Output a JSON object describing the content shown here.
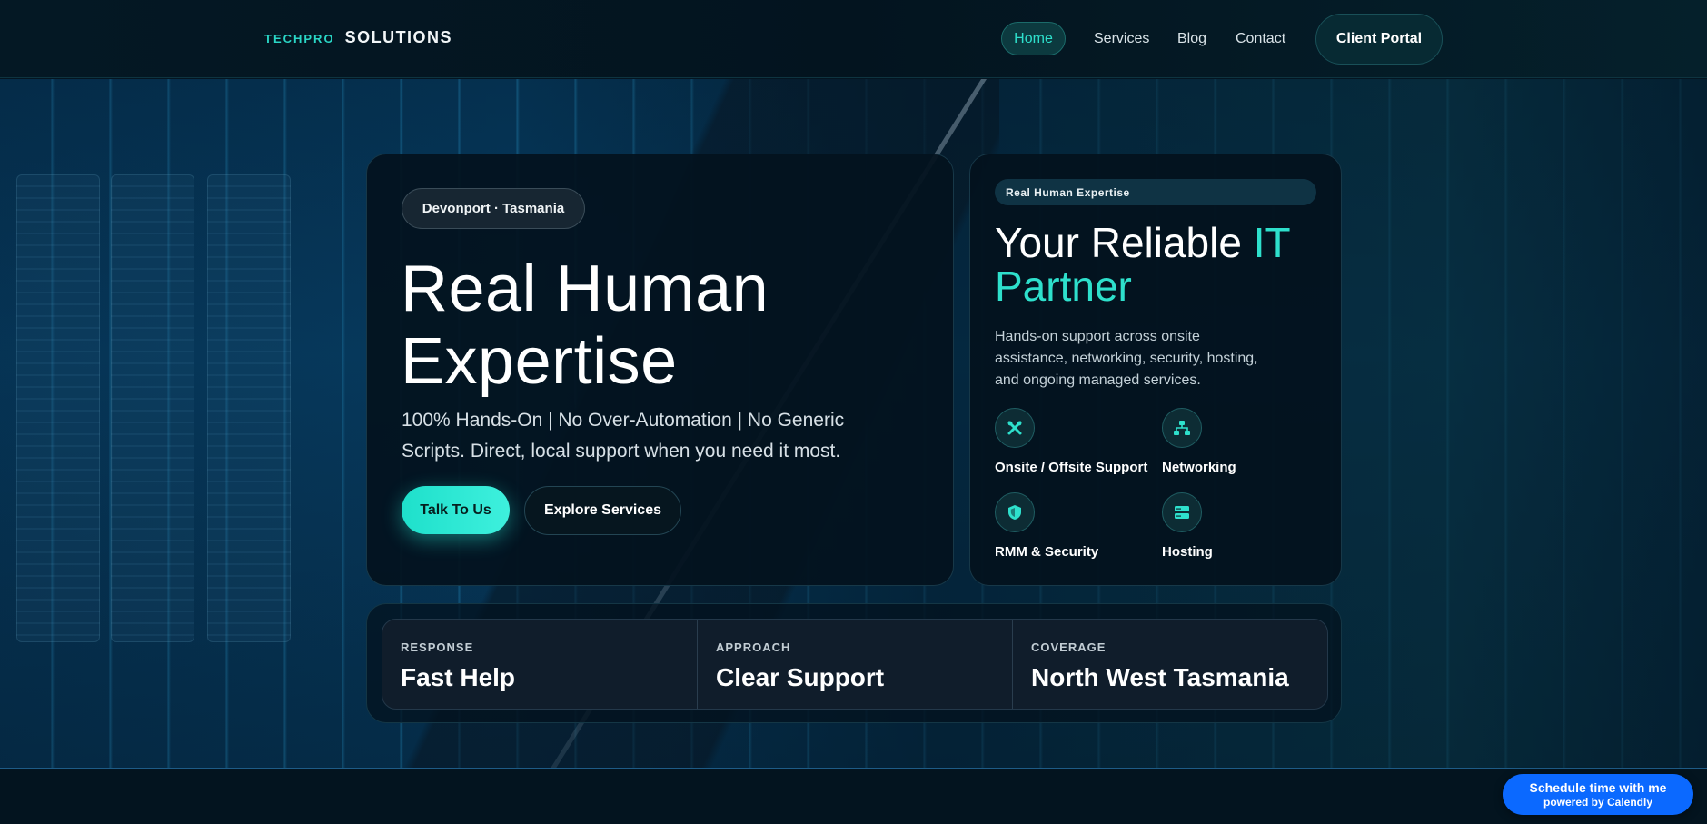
{
  "header": {
    "logo_small": "TECHPRO",
    "logo_main": "SOLUTIONS",
    "nav": [
      "Home",
      "Services",
      "Blog",
      "Contact"
    ],
    "active_nav": "Home",
    "client_portal": "Client Portal"
  },
  "hero": {
    "location": "Devonport · Tasmania",
    "title_line1": "Real Human",
    "title_line2": "Expertise",
    "subtitle": "100% Hands-On | No Over-Automation | No Generic Scripts. Direct, local support when you need it most.",
    "primary_cta": "Talk To Us",
    "secondary_cta": "Explore Services"
  },
  "partner": {
    "tag": "Real Human Expertise",
    "title_plain": "Your Reliable ",
    "title_accent": "IT Partner",
    "description": "Hands-on support across onsite assistance, networking, security, hosting, and ongoing managed services.",
    "services": [
      {
        "label": "Onsite / Offsite Support",
        "icon": "tools-icon"
      },
      {
        "label": "Networking",
        "icon": "network-icon"
      },
      {
        "label": "RMM & Security",
        "icon": "shield-icon"
      },
      {
        "label": "Hosting",
        "icon": "server-icon"
      }
    ]
  },
  "stats": [
    {
      "key": "RESPONSE",
      "value": "Fast Help"
    },
    {
      "key": "APPROACH",
      "value": "Clear Support"
    },
    {
      "key": "COVERAGE",
      "value": "North West Tasmania"
    }
  ],
  "calendly": {
    "line1": "Schedule time with me",
    "line2": "powered by Calendly"
  },
  "colors": {
    "accent": "#2ee0cc",
    "background": "#041521",
    "calendly": "#0b69ff"
  }
}
